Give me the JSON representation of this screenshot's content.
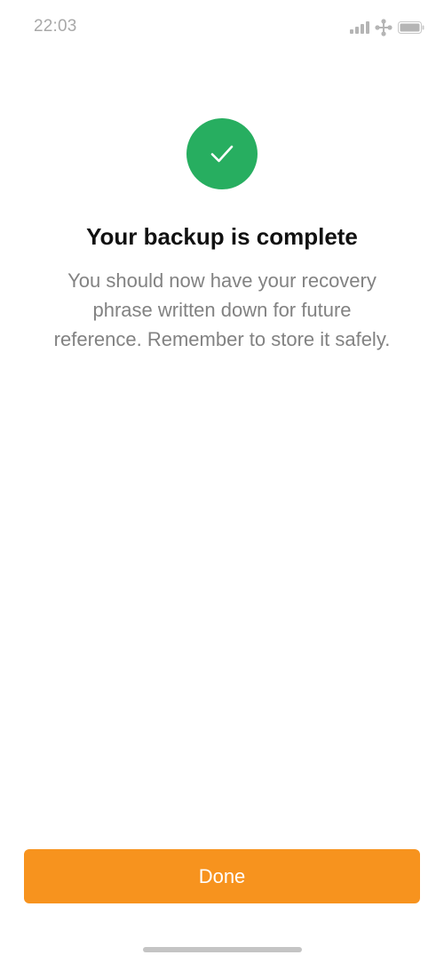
{
  "status_bar": {
    "time": "22:03",
    "icons": [
      "signal-icon",
      "network-icon",
      "battery-icon"
    ],
    "icon_color": "#b5b5b5"
  },
  "success": {
    "icon": "checkmark-icon",
    "color": "#27ae60"
  },
  "main": {
    "title": "Your backup is complete",
    "description_lines": [
      "You should now have your recovery",
      "phrase written down for future",
      "reference. Remember to store it safely."
    ]
  },
  "actions": {
    "done_label": "Done",
    "done_color": "#f7931e"
  }
}
